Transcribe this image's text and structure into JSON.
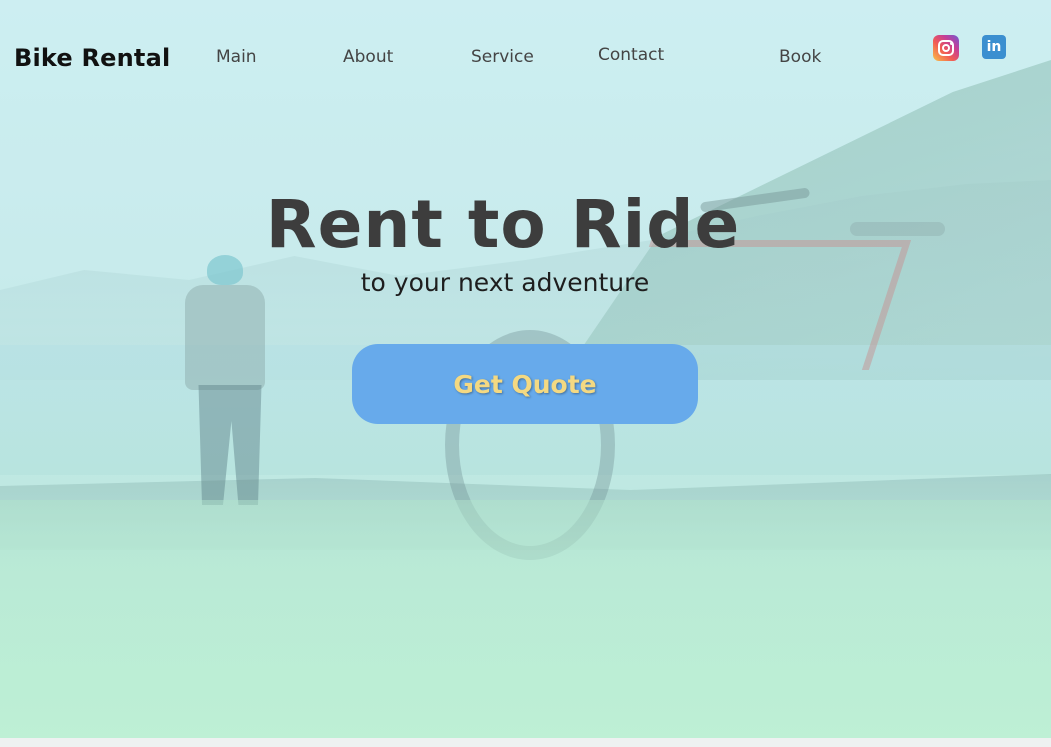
{
  "header": {
    "brand": "Bike Rental",
    "nav": [
      {
        "label": "Main"
      },
      {
        "label": "About"
      },
      {
        "label": "Service"
      },
      {
        "label": "Contact"
      },
      {
        "label": "Book"
      }
    ],
    "social": [
      {
        "icon": "instagram-icon"
      },
      {
        "icon": "linkedin-icon",
        "glyph": "in"
      }
    ]
  },
  "hero": {
    "headline": "Rent to Ride",
    "subheadline": "to your next adventure",
    "cta_label": "Get Quote"
  },
  "colors": {
    "cta_background": "#67aaeb",
    "cta_text": "#f4d982",
    "headline": "#3d3d3d",
    "linkedin": "#3b8fd0"
  }
}
